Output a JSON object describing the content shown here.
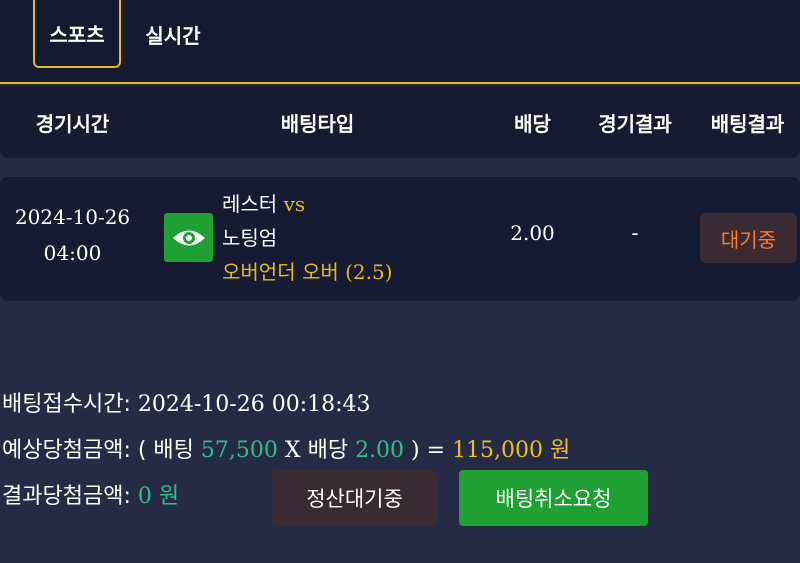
{
  "tabs": [
    {
      "label": "스포츠",
      "active": true
    },
    {
      "label": "실시간",
      "active": false
    }
  ],
  "table": {
    "headers": {
      "time": "경기시간",
      "bet_type": "배팅타입",
      "odds": "배당",
      "game_result": "경기결과",
      "bet_result": "배팅결과"
    },
    "row": {
      "date": "2024-10-26",
      "time": "04:00",
      "sport_icon": "eye-icon",
      "home_team": "레스터",
      "vs": "vs",
      "away_team": "노팅엄",
      "pick_label": "오버언더 오버",
      "pick_value": "(2.5)",
      "odds": "2.00",
      "game_result": "-",
      "status": "대기중"
    }
  },
  "summary": {
    "received_label": "배팅접수시간:",
    "received_value": "2024-10-26 00:18:43",
    "expected_label": "예상당첨금액:",
    "open_paren": "( 배팅",
    "bet_amount": "57,500",
    "times": "X",
    "odds_label": "배당",
    "odds_value": "2.00",
    "close_paren": ") =",
    "payout": "115,000 원",
    "result_label": "결과당첨금액:",
    "result_value": "0 원"
  },
  "buttons": {
    "pending": "정산대기중",
    "cancel": "배팅취소요청"
  },
  "colors": {
    "background": "#262b45",
    "panel": "#161b31",
    "accent": "#e8b923",
    "green": "#1ea033",
    "status_orange": "#ff7a2a"
  }
}
